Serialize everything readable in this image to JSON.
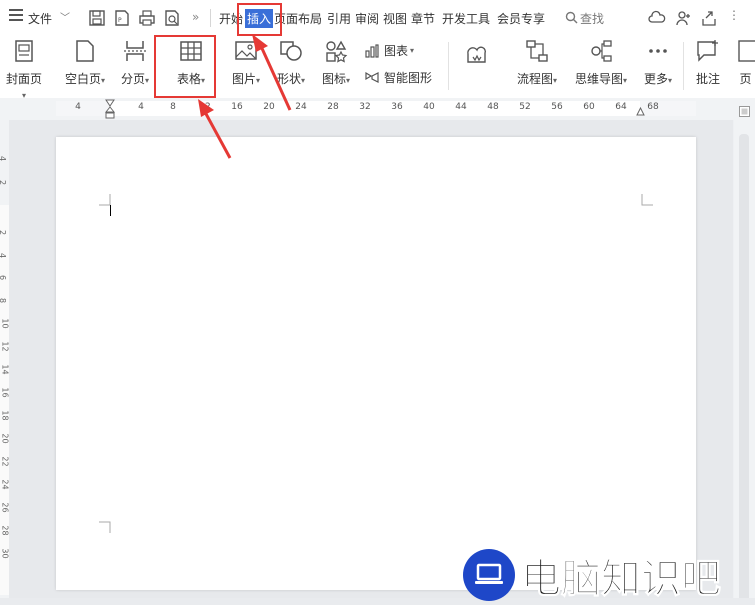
{
  "menubar": {
    "file_label": "文件",
    "tabs": [
      {
        "label": "开始",
        "active": false
      },
      {
        "label": "插入",
        "active": true
      },
      {
        "label": "页面布局",
        "active": false
      },
      {
        "label": "引用",
        "active": false
      },
      {
        "label": "审阅",
        "active": false
      },
      {
        "label": "视图",
        "active": false
      },
      {
        "label": "章节",
        "active": false
      },
      {
        "label": "开发工具",
        "active": false
      },
      {
        "label": "会员专享",
        "active": false
      }
    ],
    "search_label": "查找",
    "more_glyph": "»"
  },
  "ribbon": {
    "buttons": [
      {
        "label": "封面页",
        "icon": "cover-page-icon"
      },
      {
        "label": "空白页",
        "icon": "blank-page-icon"
      },
      {
        "label": "分页",
        "icon": "page-break-icon"
      },
      {
        "label": "表格",
        "icon": "table-icon"
      },
      {
        "label": "图片",
        "icon": "picture-icon"
      },
      {
        "label": "形状",
        "icon": "shape-icon"
      },
      {
        "label": "图标",
        "icon": "icons-icon"
      },
      {
        "label": "图表",
        "icon": "chart-icon"
      },
      {
        "label": "智能图形",
        "icon": "smart-art-icon"
      },
      {
        "label": "流程图",
        "icon": "flowchart-icon"
      },
      {
        "label": "思维导图",
        "icon": "mindmap-icon"
      },
      {
        "label": "更多",
        "icon": "more-icon"
      },
      {
        "label": "批注",
        "icon": "comment-icon"
      },
      {
        "label": "页",
        "icon": "page-icon"
      }
    ]
  },
  "ruler": {
    "ticks": [
      "4",
      "4",
      "8",
      "12",
      "16",
      "20",
      "24",
      "28",
      "32",
      "36",
      "40",
      "44",
      "48",
      "52",
      "56",
      "60",
      "64",
      "68"
    ]
  },
  "vruler": {
    "ticks": [
      "4",
      "2",
      "2",
      "4",
      "6",
      "8",
      "10",
      "12",
      "14",
      "16",
      "18",
      "20",
      "22",
      "24",
      "26",
      "28",
      "30"
    ]
  },
  "watermark": {
    "text": "电脑知识吧"
  },
  "colors": {
    "accent": "#3a6fd8",
    "highlight": "#e53935",
    "watermark_blue": "#1e47c8"
  }
}
